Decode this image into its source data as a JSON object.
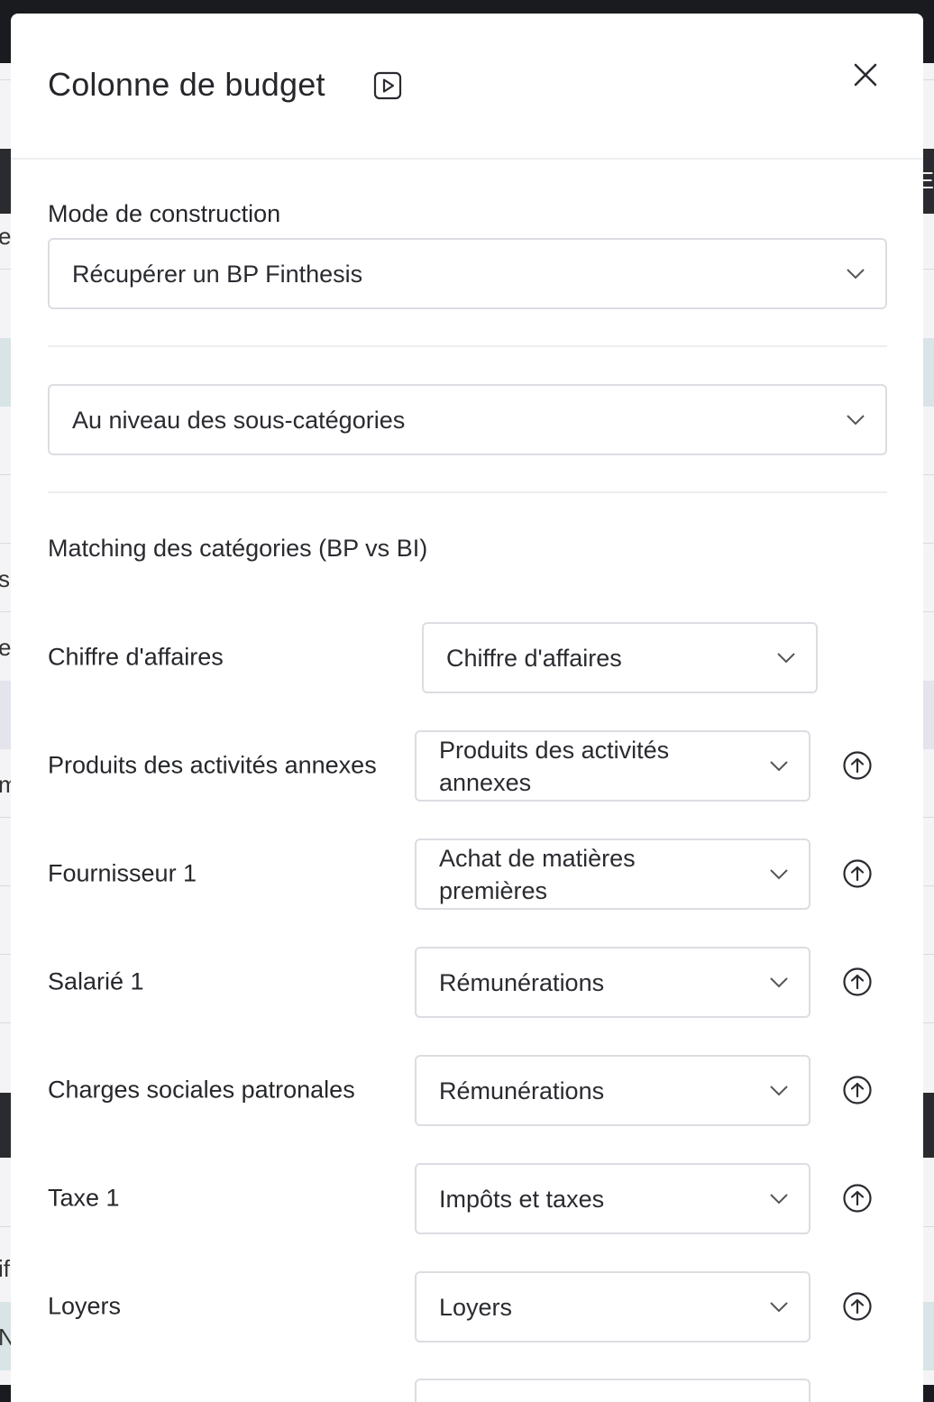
{
  "modal": {
    "title": "Colonne de budget",
    "video_icon": "play-video-icon",
    "close_icon": "close-icon"
  },
  "construction": {
    "label": "Mode de construction",
    "selected": "Récupérer un BP Finthesis"
  },
  "level": {
    "selected": "Au niveau des sous-catégories"
  },
  "matching": {
    "title": "Matching des catégories (BP vs BI)",
    "rows": [
      {
        "label": "Chiffre d'affaires",
        "value": "Chiffre d'affaires"
      },
      {
        "label": "Produits des activités annexes",
        "value": "Produits des activités annexes"
      },
      {
        "label": "Fournisseur 1",
        "value": "Achat de matières premières"
      },
      {
        "label": "Salarié 1",
        "value": "Rémunérations"
      },
      {
        "label": "Charges sociales patronales",
        "value": "Rémunérations"
      },
      {
        "label": "Taxe 1",
        "value": "Impôts et taxes"
      },
      {
        "label": "Loyers",
        "value": "Loyers"
      }
    ]
  },
  "background_fragments": [
    "e",
    "s",
    "e",
    "m",
    "if",
    "N'",
    "E"
  ],
  "colors": {
    "text": "#26272b",
    "border": "#dcdde2",
    "divider": "#eceef1",
    "backdrop": "#1a1b1f"
  }
}
